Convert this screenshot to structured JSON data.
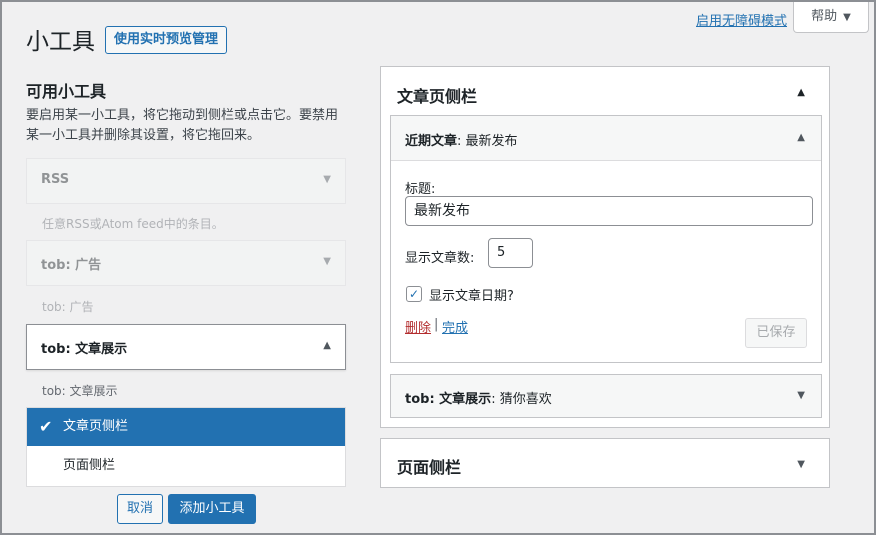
{
  "header": {
    "title": "小工具",
    "preview_button": "使用实时预览管理",
    "a11y_link": "启用无障碍模式",
    "help_tab": "帮助"
  },
  "available": {
    "title": "可用小工具",
    "description": "要启用某一小工具，将它拖动到侧栏或点击它。要禁用某一小工具并删除其设置，将它拖回来。",
    "widgets": [
      {
        "title": "RSS",
        "desc": "任意RSS或Atom feed中的条目。"
      },
      {
        "title": "tob: 广告",
        "desc": "tob: 广告"
      },
      {
        "title": "tob: 文章展示",
        "desc": "tob: 文章展示"
      }
    ],
    "chooser": {
      "options": [
        "文章页侧栏",
        "页面侧栏"
      ],
      "selected": "文章页侧栏"
    },
    "cancel_label": "取消",
    "add_label": "添加小工具"
  },
  "sidebars": {
    "article": {
      "title": "文章页侧栏",
      "open_widget": {
        "name": "近期文章",
        "subtitle": "最新发布",
        "title_label": "标题:",
        "title_value": "最新发布",
        "count_label": "显示文章数:",
        "count_value": "5",
        "show_date_label": "显示文章日期?",
        "show_date_checked": true,
        "delete_label": "删除",
        "separator": "|",
        "done_label": "完成",
        "saved_label": "已保存"
      },
      "closed_widget": {
        "name": "tob: 文章展示",
        "subtitle": "猜你喜欢"
      }
    },
    "page": {
      "title": "页面侧栏"
    }
  },
  "colors": {
    "accent": "#2271b1",
    "danger": "#b32d2e"
  }
}
